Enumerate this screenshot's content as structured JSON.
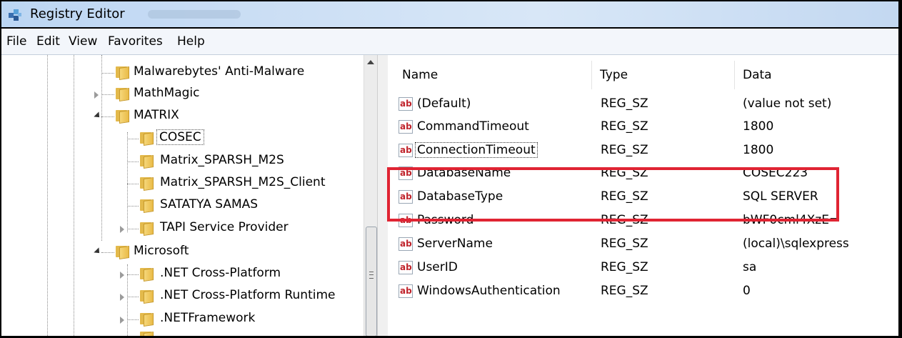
{
  "window": {
    "title": "Registry Editor"
  },
  "menu": [
    "File",
    "Edit",
    "View",
    "Favorites",
    "Help"
  ],
  "tree": [
    {
      "label": "Malwarebytes' Anti-Malware"
    },
    {
      "label": "MathMagic"
    },
    {
      "label": "MATRIX"
    },
    {
      "label": "COSEC"
    },
    {
      "label": "Matrix_SPARSH_M2S"
    },
    {
      "label": "Matrix_SPARSH_M2S_Client"
    },
    {
      "label": "SATATYA SAMAS"
    },
    {
      "label": "TAPI Service Provider"
    },
    {
      "label": "Microsoft"
    },
    {
      "label": ".NET Cross-Platform"
    },
    {
      "label": ".NET Cross-Platform Runtime"
    },
    {
      "label": ".NETFramework"
    }
  ],
  "columns": {
    "name": "Name",
    "type": "Type",
    "data": "Data"
  },
  "values": [
    {
      "name": "(Default)",
      "type": "REG_SZ",
      "data": "(value not set)"
    },
    {
      "name": "CommandTimeout",
      "type": "REG_SZ",
      "data": "1800"
    },
    {
      "name": "ConnectionTimeout",
      "type": "REG_SZ",
      "data": "1800"
    },
    {
      "name": "DatabaseName",
      "type": "REG_SZ",
      "data": "COSEC223"
    },
    {
      "name": "DatabaseType",
      "type": "REG_SZ",
      "data": "SQL SERVER"
    },
    {
      "name": "Password",
      "type": "REG_SZ",
      "data": "bWF0cml4XzE="
    },
    {
      "name": "ServerName",
      "type": "REG_SZ",
      "data": "(local)\\sqlexpress"
    },
    {
      "name": "UserID",
      "type": "REG_SZ",
      "data": "sa"
    },
    {
      "name": "WindowsAuthentication",
      "type": "REG_SZ",
      "data": "0"
    }
  ],
  "icons": {
    "app": "registry-editor-icon",
    "folder": "folder-icon",
    "value": "string-value-ab-icon"
  },
  "colors": {
    "highlight": "#e02433",
    "titlebar": "#c9ddf4",
    "folder": "#e9bb47"
  }
}
